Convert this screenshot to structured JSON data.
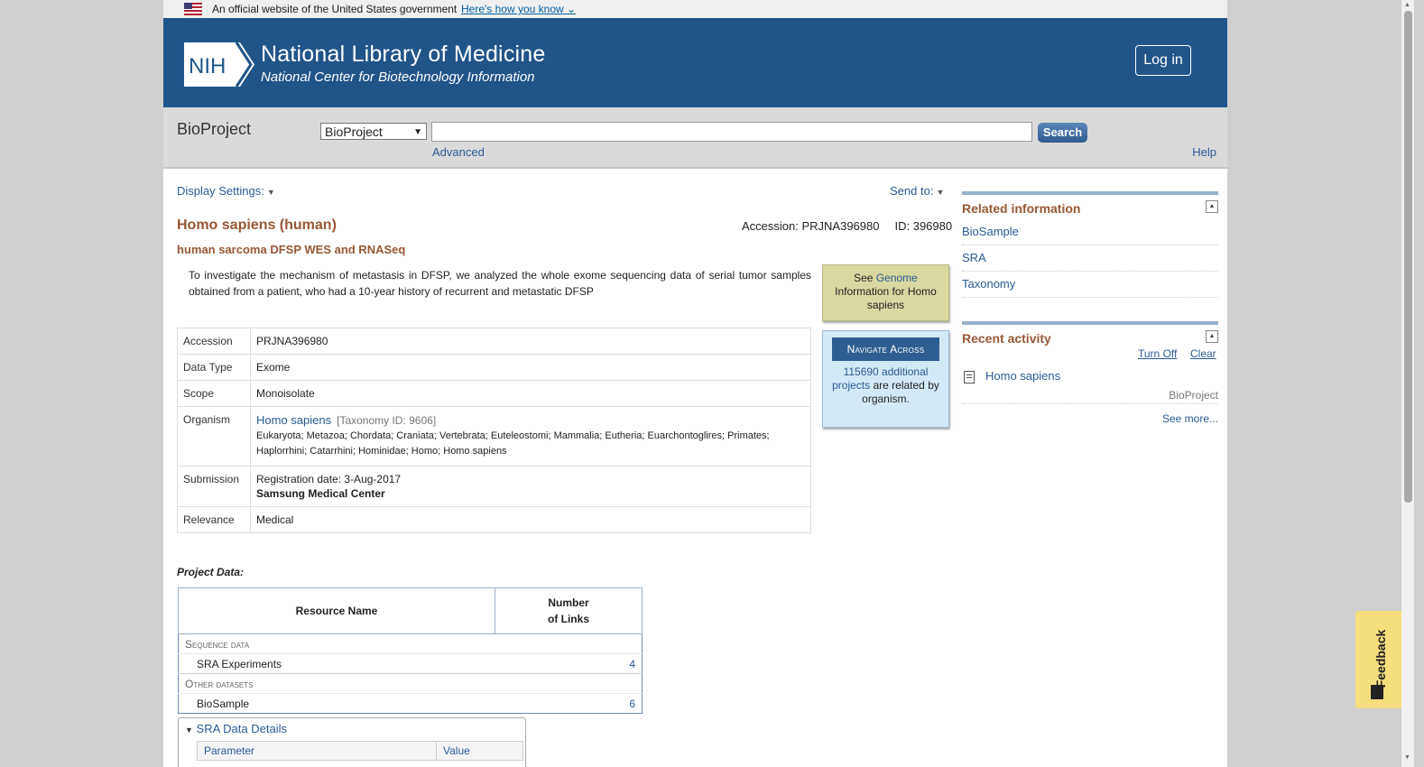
{
  "gov_banner": {
    "text": "An official website of the United States government",
    "link": "Here's how you know"
  },
  "header": {
    "logo": "NIH",
    "title": "National Library of Medicine",
    "subtitle": "National Center for Biotechnology Information",
    "login": "Log in"
  },
  "search": {
    "db_label": "BioProject",
    "db_selected": "BioProject",
    "query": "",
    "button": "Search",
    "advanced": "Advanced",
    "help": "Help"
  },
  "toolbar": {
    "display_settings": "Display Settings:",
    "send_to": "Send to:"
  },
  "record": {
    "organism_title": "Homo sapiens (human)",
    "accession_label": "Accession: PRJNA396980",
    "id_label": "ID: 396980",
    "project_title": "human sarcoma DFSP WES and RNASeq",
    "description": "To investigate the mechanism of metastasis in DFSP, we analyzed the whole exome sequencing data of serial tumor samples obtained from a patient, who had a 10-year history of recurrent and metastatic DFSP"
  },
  "genome_box": {
    "see": "See",
    "link": "Genome",
    "rest": "Information for Homo sapiens"
  },
  "navigate_box": {
    "title": "Navigate Across",
    "link": "115690 additional projects",
    "rest": "are related by organism."
  },
  "details": {
    "accession": {
      "label": "Accession",
      "value": "PRJNA396980"
    },
    "data_type": {
      "label": "Data Type",
      "value": "Exome"
    },
    "scope": {
      "label": "Scope",
      "value": "Monoisolate"
    },
    "organism": {
      "label": "Organism",
      "name": "Homo sapiens",
      "taxonomy": "[Taxonomy ID: 9606]",
      "lineage": "Eukaryota; Metazoa; Chordata; Craniata; Vertebrata; Euteleostomi; Mammalia; Eutheria; Euarchontoglires; Primates; Haplorrhini; Catarrhini; Hominidae; Homo; Homo sapiens"
    },
    "submission": {
      "label": "Submission",
      "date": "Registration date: 3-Aug-2017",
      "center": "Samsung Medical Center"
    },
    "relevance": {
      "label": "Relevance",
      "value": "Medical"
    }
  },
  "project_data": {
    "label": "Project Data:",
    "col_resource": "Resource Name",
    "col_links_1": "Number",
    "col_links_2": "of Links",
    "sections": [
      {
        "name": "Sequence data",
        "rows": [
          {
            "name": "SRA Experiments",
            "count": "4"
          }
        ]
      },
      {
        "name": "Other datasets",
        "rows": [
          {
            "name": "BioSample",
            "count": "6"
          }
        ]
      }
    ]
  },
  "sra_details": {
    "title": "SRA Data Details",
    "col_param": "Parameter",
    "col_value": "Value"
  },
  "related": {
    "title": "Related information",
    "links": [
      "BioSample",
      "SRA",
      "Taxonomy"
    ]
  },
  "recent": {
    "title": "Recent activity",
    "turn_off": "Turn Off",
    "clear": "Clear",
    "item_title": "Homo sapiens",
    "item_db": "BioProject",
    "see_more": "See more..."
  },
  "feedback": "Feedback"
}
